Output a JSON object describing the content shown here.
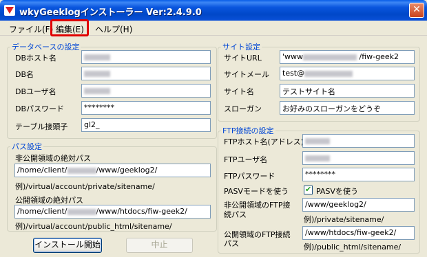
{
  "window": {
    "title": "wkyGeeklogインストーラー Ver:2.4.9.0",
    "close_glyph": "✕"
  },
  "menu": {
    "file": "ファイル(F)",
    "edit": "編集(E)",
    "help": "ヘルプ(H)"
  },
  "database": {
    "legend": "データベースの設定",
    "host_label": "DBホスト名",
    "name_label": "DB名",
    "user_label": "DBユーザ名",
    "password_label": "DBパスワード",
    "password_value": "********",
    "prefix_label": "テーブル接頭子",
    "prefix_value": "gl2_"
  },
  "paths": {
    "legend": "パス設定",
    "private_label": "非公開領域の絶対パス",
    "private_prefix": "/home/client/",
    "private_suffix": "/www/geeklog2/",
    "private_example": "例)/virtual/account/private/sitename/",
    "public_label": "公開領域の絶対パス",
    "public_prefix": "/home/client/",
    "public_suffix": "/www/htdocs/fiw-geek2/",
    "public_example": "例)/virtual/account/public_html/sitename/"
  },
  "site": {
    "legend": "サイト設定",
    "url_label": "サイトURL",
    "url_prefix": "'www",
    "url_suffix": "/fiw-geek2",
    "mail_label": "サイトメール",
    "mail_value": "test@",
    "name_label": "サイト名",
    "name_value": "テストサイト名",
    "slogan_label": "スローガン",
    "slogan_value": "お好みのスローガンをどうぞ"
  },
  "ftp": {
    "legend": "FTP接続の設定",
    "host_label": "FTPホスト名(アドレス)",
    "user_label": "FTPユーザ名",
    "password_label": "FTPパスワード",
    "password_value": "********",
    "pasv_label": "PASVモードを使う",
    "pasv_checkbox_label": "PASVを使う",
    "pasv_checked": true,
    "private_label_line1": "非公開領域のFTP接",
    "private_label_line2": "続パス",
    "private_value": "/www/geeklog2/",
    "private_example": "例)/private/sitename/",
    "public_label_line1": "公開領域のFTP接続",
    "public_label_line2": "パス",
    "public_value": "/www/htdocs/fiw-geek2/",
    "public_example": "例)/public_html/sitename/"
  },
  "buttons": {
    "install": "インストール開始",
    "cancel": "中止"
  },
  "colors": {
    "titlebar": "#0a56de",
    "legend": "#0046d5",
    "highlight": "#e00000"
  }
}
